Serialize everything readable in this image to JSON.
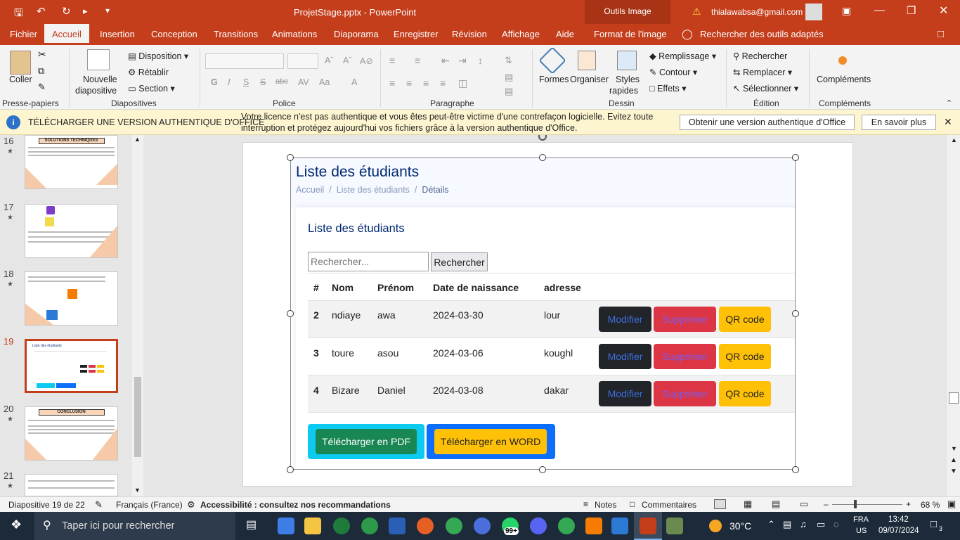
{
  "titlebar": {
    "title": "ProjetStage.pptx  -  PowerPoint",
    "context_tab": "Outils Image",
    "user_email": "thialawabsa@gmail.com"
  },
  "tabs": [
    "Fichier",
    "Accueil",
    "Insertion",
    "Conception",
    "Transitions",
    "Animations",
    "Diaporama",
    "Enregistrer",
    "Révision",
    "Affichage",
    "Aide",
    "Format de l'image",
    "Rechercher des outils adaptés"
  ],
  "ribbon": {
    "coller": "Coller",
    "nouvelle1": "Nouvelle",
    "nouvelle2": "diapositive",
    "disposition": "Disposition",
    "retablir": "Rétablir",
    "section": "Section",
    "formes": "Formes",
    "organiser": "Organiser",
    "styles1": "Styles",
    "styles2": "rapides",
    "remplissage": "Remplissage",
    "contour": "Contour",
    "effets": "Effets",
    "rechercher": "Rechercher",
    "remplacer": "Remplacer",
    "selectionner": "Sélectionner",
    "complements": "Compléments",
    "groups": {
      "presse": "Presse-papiers",
      "diapos": "Diapositives",
      "police": "Police",
      "para": "Paragraphe",
      "dessin": "Dessin",
      "edition": "Édition",
      "compl": "Compléments"
    }
  },
  "msgbar": {
    "title": "TÉLÉCHARGER UNE VERSION AUTHENTIQUE D'OFFICE",
    "line1": "Votre licence n'est pas authentique et vous êtes peut-être victime d'une contrefaçon logicielle. Evitez toute",
    "line2": "interruption et protégez aujourd'hui vos fichiers grâce à la version authentique d'Office.",
    "btn1": "Obtenir une version authentique d'Office",
    "btn2": "En savoir plus"
  },
  "thumbs": [
    {
      "num": "16",
      "title": "SOLUTIONS TECHNIQUES"
    },
    {
      "num": "17",
      "title": ""
    },
    {
      "num": "18",
      "title": ""
    },
    {
      "num": "19",
      "title": "Liste des étudiants"
    },
    {
      "num": "20",
      "title": "CONCLUSION"
    },
    {
      "num": "21",
      "title": ""
    }
  ],
  "slide": {
    "page_title": "Liste des étudiants",
    "breadcrumb": [
      "Accueil",
      "/",
      "Liste des étudiants",
      "/",
      "Détails"
    ],
    "card_title": "Liste des étudiants",
    "search_placeholder": "Rechercher...",
    "search_button": "Rechercher",
    "columns": [
      "#",
      "Nom",
      "Prénom",
      "Date de naissance",
      "adresse"
    ],
    "rows": [
      {
        "id": "2",
        "nom": "ndiaye",
        "prenom": "awa",
        "date": "2024-03-30",
        "adresse": "lour"
      },
      {
        "id": "3",
        "nom": "toure",
        "prenom": "asou",
        "date": "2024-03-06",
        "adresse": "koughl"
      },
      {
        "id": "4",
        "nom": "Bizare",
        "prenom": "Daniel",
        "date": "2024-03-08",
        "adresse": "dakar"
      }
    ],
    "btn_modifier": "Modifier",
    "btn_supprimer": "Supprimer",
    "btn_qr": "QR code",
    "btn_pdf": "Télécharger en PDF",
    "btn_word": "Télécharger en WORD"
  },
  "status": {
    "slide": "Diapositive 19 de 22",
    "lang": "Français (France)",
    "access": "Accessibilité : consultez nos recommandations",
    "notes": "Notes",
    "comments": "Commentaires",
    "zoom": "68 %"
  },
  "taskbar": {
    "search": "Taper ici pour rechercher",
    "badge": "99+",
    "temp": "30°C",
    "lang1": "FRA",
    "lang2": "US",
    "time": "13:42",
    "date": "09/07/2024",
    "notif": "3"
  },
  "colors": {
    "accent": "#c43e1c",
    "dark_btn": "#212529",
    "danger": "#dc3545",
    "warning": "#ffc107",
    "success": "#198754",
    "info": "#0dcaf0",
    "primary": "#0d6efd"
  }
}
